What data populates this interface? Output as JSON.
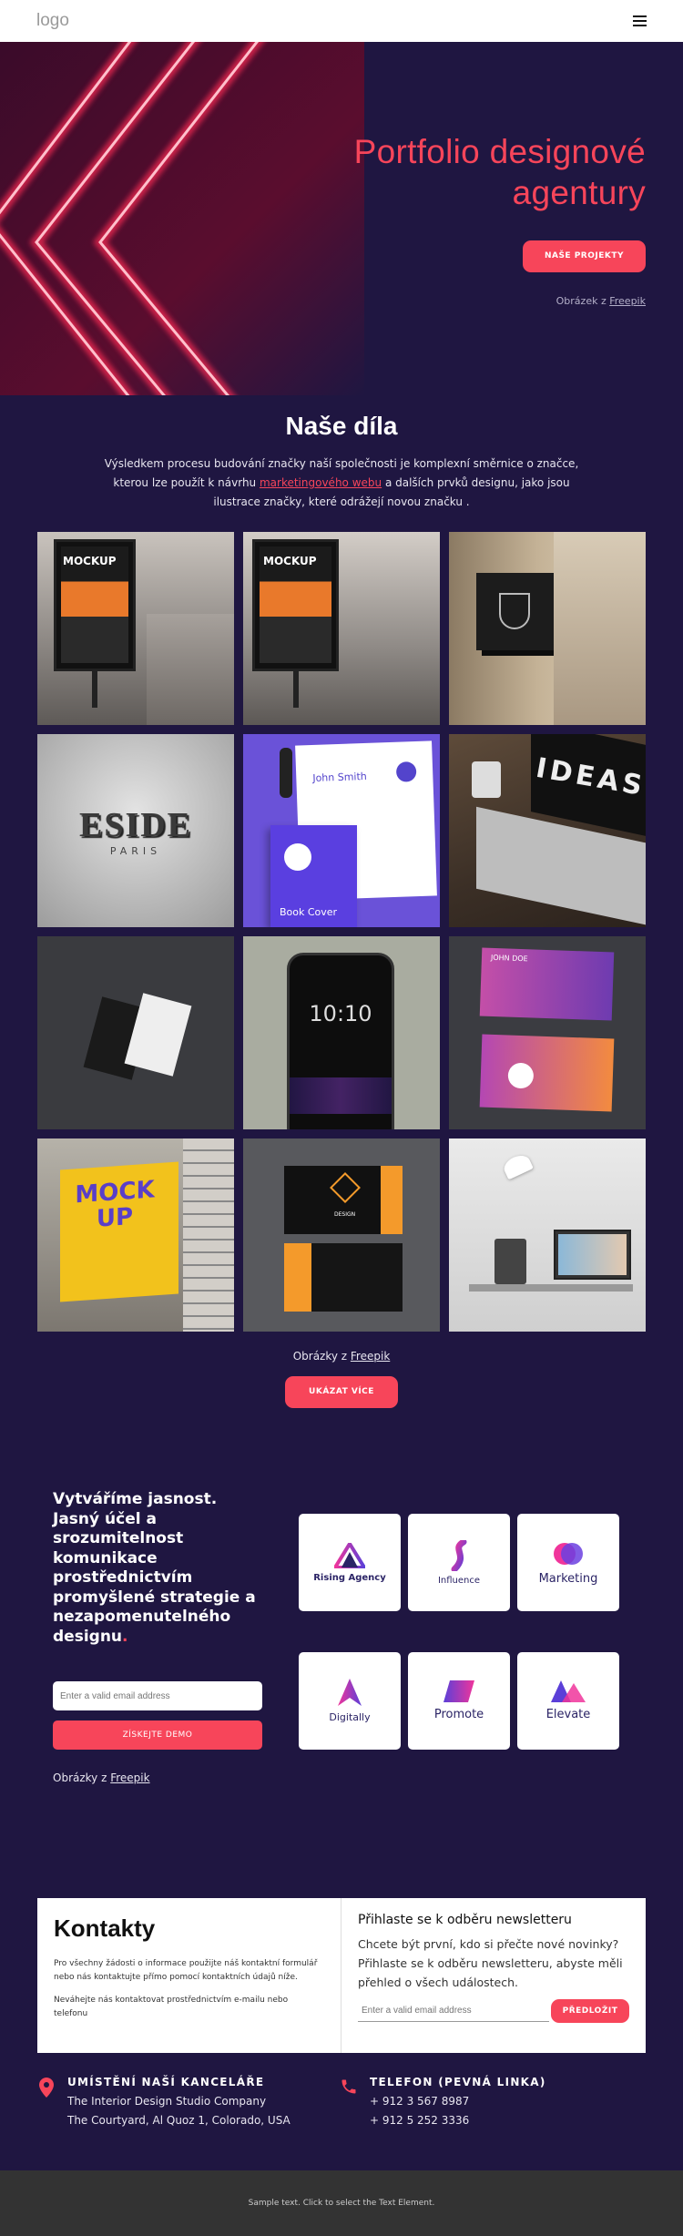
{
  "header": {
    "logo": "logo",
    "menu_icon": "hamburger-icon"
  },
  "hero": {
    "title_line1": "Portfolio designové",
    "title_line2": "agentury",
    "button": "NAŠE PROJEKTY",
    "credit_prefix": "Obrázek z ",
    "credit_link": "Freepik"
  },
  "works": {
    "title": "Naše díla",
    "desc_part1": "Výsledkem procesu budování značky naší společnosti je komplexní směrnice o značce, kterou lze použít k návrhu ",
    "desc_link": "marketingového webu",
    "desc_part2": " a dalších prvků designu, jako jsou ilustrace značky, které odrážejí novou značku .",
    "tiles": [
      {
        "name": "billboard-mockup-street",
        "caption": "MOCKUP"
      },
      {
        "name": "billboard-mockup-street-2",
        "caption": "MOCKUP"
      },
      {
        "name": "wall-sign-logo",
        "caption": ""
      },
      {
        "name": "eside-paris-3d-logo",
        "caption": "ESIDE",
        "sub": "PARIS"
      },
      {
        "name": "stationery-book-cover",
        "caption": "John Smith",
        "sub": "Book Cover"
      },
      {
        "name": "laptop-ideas",
        "caption": "IDEAS"
      },
      {
        "name": "business-cards-dark",
        "caption": ""
      },
      {
        "name": "smartphone-mockup",
        "caption": "10:10"
      },
      {
        "name": "purple-business-cards",
        "caption": "JOHN DOE"
      },
      {
        "name": "mock-up-billboard-building",
        "caption": "MOCK UP"
      },
      {
        "name": "orange-black-business-cards",
        "caption": "DESIGN"
      },
      {
        "name": "desk-lamp-laptop",
        "caption": ""
      }
    ],
    "credit_prefix": "Obrázky z ",
    "credit_link": "Freepik",
    "more_button": "UKÁZAT VÍCE"
  },
  "clarity": {
    "title": "Vytváříme jasnost. Jasný účel a srozumitelnost komunikace prostřednictvím promyšlené strategie a nezapomenutelného designu",
    "title_dot": ".",
    "email_placeholder": "Enter a valid email address",
    "demo_button": "ZÍSKEJTE DEMO",
    "credit_prefix": "Obrázky z ",
    "credit_link": "Freepik",
    "logos": [
      {
        "label": "Rising Agency"
      },
      {
        "label": "Influence"
      },
      {
        "label": "Marketing"
      },
      {
        "label": "Digitally"
      },
      {
        "label": "Promote"
      },
      {
        "label": "Elevate"
      }
    ]
  },
  "contact": {
    "title": "Kontakty",
    "text1": "Pro všechny žádosti o informace použijte náš kontaktní formulář nebo nás kontaktujte přímo pomocí kontaktních údajů níže.",
    "text2": "Neváhejte nás kontaktovat prostřednictvím e-mailu nebo telefonu",
    "newsletter_title": "Přihlaste se k odběru newsletteru",
    "newsletter_text": "Chcete být první, kdo si přečte nové novinky? Přihlaste se k odběru newsletteru, abyste měli přehled o všech událostech.",
    "newsletter_placeholder": "Enter a valid email address",
    "newsletter_button": "PŘEDLOŽIT"
  },
  "info": {
    "office_title": "UMÍSTĚNÍ NAŠÍ KANCELÁŘE",
    "office_line1": "The Interior Design Studio Company",
    "office_line2": "The Courtyard, Al Quoz 1, Colorado,  USA",
    "phone_title": "TELEFON (PEVNÁ LINKA)",
    "phone_line1": "+ 912 3 567 8987",
    "phone_line2": "+ 912 5 252 3336"
  },
  "footer": {
    "text": "Sample text. Click to select the Text Element."
  },
  "colors": {
    "accent": "#f7455a",
    "background": "#1f1641"
  }
}
